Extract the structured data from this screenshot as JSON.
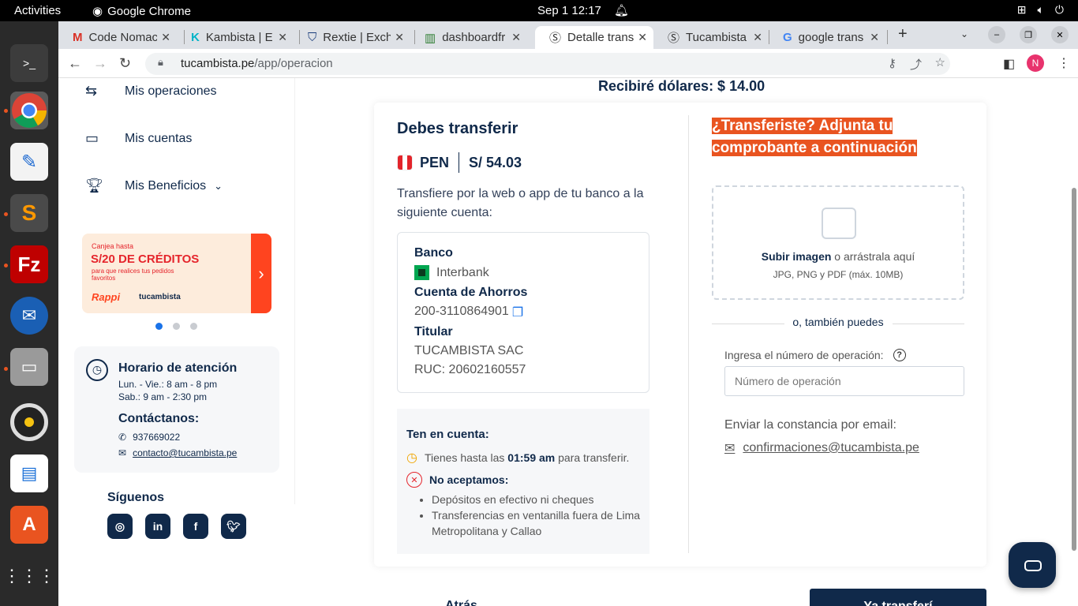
{
  "topbar": {
    "activities": "Activities",
    "app": "Google Chrome",
    "clock": "Sep 1  12:17"
  },
  "tabs": [
    {
      "label": "Code Nomac",
      "icon": "gmail-icon"
    },
    {
      "label": "Kambista | E",
      "icon": "kambista-icon"
    },
    {
      "label": "Rextie | Exch",
      "icon": "rextie-icon"
    },
    {
      "label": "dashboardfr",
      "icon": "dashboard-icon"
    },
    {
      "label": "Detalle trans",
      "icon": "tucambista-icon"
    },
    {
      "label": "Tucambista",
      "icon": "tucambista-icon"
    },
    {
      "label": "google trans",
      "icon": "google-icon"
    }
  ],
  "browser": {
    "url_host": "tucambista.pe",
    "url_path": "/app/operacion",
    "profile": "N"
  },
  "sidebar": {
    "items": [
      {
        "label": "Mis operaciones",
        "icon": "exchange-arrows-icon"
      },
      {
        "label": "Mis cuentas",
        "icon": "card-icon"
      },
      {
        "label": "Mis Beneficios",
        "icon": "trophy-icon"
      }
    ]
  },
  "promo": {
    "line1": "Canjea hasta",
    "line2": "S/20 DE CRÉDITOS",
    "line3": "para que realices tus pedidos favoritos",
    "brand1": "Rappi",
    "brand2": "tucambista"
  },
  "hours": {
    "title": "Horario de atención",
    "weekday": "Lun. - Vie.: 8 am - 8 pm",
    "saturday": "Sab.: 9 am - 2:30 pm",
    "contact_title": "Contáctanos:",
    "phone": "937669022",
    "email": "contacto@tucambista.pe"
  },
  "follow": {
    "title": "Síguenos",
    "networks": [
      "instagram",
      "linkedin",
      "facebook",
      "twitter"
    ]
  },
  "receive": "Recibiré dólares: $ 14.00",
  "transfer": {
    "title": "Debes transferir",
    "currency": "PEN",
    "amount": "S/ 54.03",
    "description": "Transfiere por la web o app de tu banco a la siguiente cuenta:",
    "bank_label": "Banco",
    "bank": "Interbank",
    "account_label": "Cuenta de Ahorros",
    "account": "200-3110864901",
    "holder_label": "Titular",
    "holder": "TUCAMBISTA SAC",
    "ruc": "RUC: 20602160557"
  },
  "note": {
    "title": "Ten en cuenta:",
    "deadline_pre": "Tienes hasta las",
    "deadline_time": "01:59 am",
    "deadline_post": "para transferir.",
    "not_accepted": "No aceptamos:",
    "bullets": [
      "Depósitos en efectivo ni cheques",
      "Transferencias en ventanilla fuera de Lima Metropolitana y Callao"
    ]
  },
  "upload": {
    "title_line1": "¿Transferiste? Adjunta tu",
    "title_line2": "comprobante a continuación",
    "link": "Subir imagen",
    "rest": " o arrástrala aquí",
    "formats": "JPG, PNG y PDF (máx. 10MB)",
    "also": "o, también puedes",
    "op_label": "Ingresa el número de operación:",
    "op_placeholder": "Número de operación",
    "email_label": "Enviar la constancia por email:",
    "email": "confirmaciones@tucambista.pe"
  },
  "footer": {
    "back": "Atrás",
    "confirm": "Ya transferí"
  },
  "colors": {
    "navy": "#10294a",
    "accent": "#e95420",
    "rappi": "#ff441f"
  }
}
